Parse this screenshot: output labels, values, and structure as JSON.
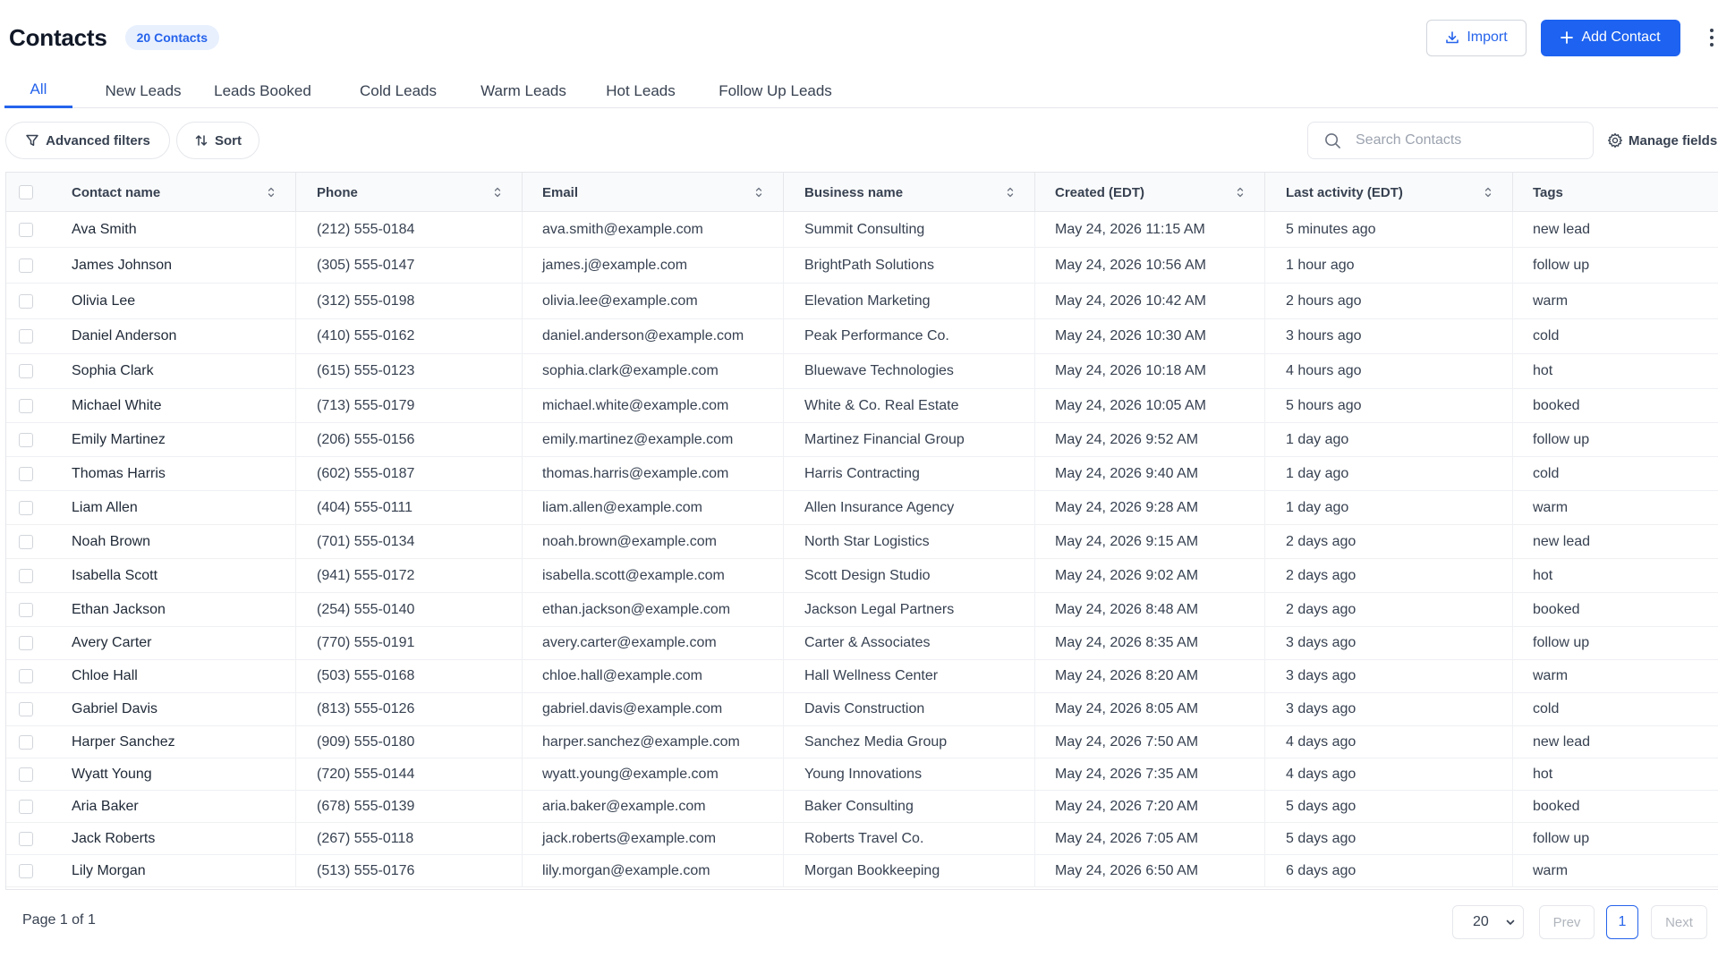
{
  "header": {
    "title": "Contacts",
    "count_badge": "20 Contacts",
    "import_label": "Import",
    "add_label": "Add Contact",
    "accent_color": "#1d62f0"
  },
  "tabs": [
    {
      "label": "All",
      "active": true
    },
    {
      "label": "New Leads",
      "active": false
    },
    {
      "label": "Leads Booked",
      "active": false
    },
    {
      "label": "Cold Leads",
      "active": false
    },
    {
      "label": "Warm Leads",
      "active": false
    },
    {
      "label": "Hot Leads",
      "active": false
    },
    {
      "label": "Follow Up Leads",
      "active": false
    }
  ],
  "toolbar": {
    "filters_label": "Advanced filters",
    "sort_label": "Sort",
    "search_placeholder": "Search Contacts",
    "manage_label": "Manage fields"
  },
  "table": {
    "columns": [
      "Contact name",
      "Phone",
      "Email",
      "Business name",
      "Created (EDT)",
      "Last activity (EDT)",
      "Tags"
    ],
    "rows": [
      [
        "Ava Smith",
        "(212) 555-0184",
        "ava.smith@example.com",
        "Summit Consulting",
        "May 24, 2026 11:15 AM",
        "5 minutes ago",
        "new lead"
      ],
      [
        "James Johnson",
        "(305) 555-0147",
        "james.j@example.com",
        "BrightPath Solutions",
        "May 24, 2026 10:56 AM",
        "1 hour ago",
        "follow up"
      ],
      [
        "Olivia Lee",
        "(312) 555-0198",
        "olivia.lee@example.com",
        "Elevation Marketing",
        "May 24, 2026 10:42 AM",
        "2 hours ago",
        "warm"
      ],
      [
        "Daniel Anderson",
        "(410) 555-0162",
        "daniel.anderson@example.com",
        "Peak Performance Co.",
        "May 24, 2026 10:30 AM",
        "3 hours ago",
        "cold"
      ],
      [
        "Sophia Clark",
        "(615) 555-0123",
        "sophia.clark@example.com",
        "Bluewave Technologies",
        "May 24, 2026 10:18 AM",
        "4 hours ago",
        "hot"
      ],
      [
        "Michael White",
        "(713) 555-0179",
        "michael.white@example.com",
        "White & Co. Real Estate",
        "May 24, 2026 10:05 AM",
        "5 hours ago",
        "booked"
      ],
      [
        "Emily Martinez",
        "(206) 555-0156",
        "emily.martinez@example.com",
        "Martinez Financial Group",
        "May 24, 2026 9:52 AM",
        "1 day ago",
        "follow up"
      ],
      [
        "Thomas Harris",
        "(602) 555-0187",
        "thomas.harris@example.com",
        "Harris Contracting",
        "May 24, 2026 9:40 AM",
        "1 day ago",
        "cold"
      ],
      [
        "Liam Allen",
        "(404) 555-0111",
        "liam.allen@example.com",
        "Allen Insurance Agency",
        "May 24, 2026 9:28 AM",
        "1 day ago",
        "warm"
      ],
      [
        "Noah Brown",
        "(701) 555-0134",
        "noah.brown@example.com",
        "North Star Logistics",
        "May 24, 2026 9:15 AM",
        "2 days ago",
        "new lead"
      ],
      [
        "Isabella Scott",
        "(941) 555-0172",
        "isabella.scott@example.com",
        "Scott Design Studio",
        "May 24, 2026 9:02 AM",
        "2 days ago",
        "hot"
      ],
      [
        "Ethan Jackson",
        "(254) 555-0140",
        "ethan.jackson@example.com",
        "Jackson Legal Partners",
        "May 24, 2026 8:48 AM",
        "2 days ago",
        "booked"
      ],
      [
        "Avery Carter",
        "(770) 555-0191",
        "avery.carter@example.com",
        "Carter & Associates",
        "May 24, 2026 8:35 AM",
        "3 days ago",
        "follow up"
      ],
      [
        "Chloe Hall",
        "(503) 555-0168",
        "chloe.hall@example.com",
        "Hall Wellness Center",
        "May 24, 2026 8:20 AM",
        "3 days ago",
        "warm"
      ],
      [
        "Gabriel Davis",
        "(813) 555-0126",
        "gabriel.davis@example.com",
        "Davis Construction",
        "May 24, 2026 8:05 AM",
        "3 days ago",
        "cold"
      ],
      [
        "Harper Sanchez",
        "(909) 555-0180",
        "harper.sanchez@example.com",
        "Sanchez Media Group",
        "May 24, 2026 7:50 AM",
        "4 days ago",
        "new lead"
      ],
      [
        "Wyatt Young",
        "(720) 555-0144",
        "wyatt.young@example.com",
        "Young Innovations",
        "May 24, 2026 7:35 AM",
        "4 days ago",
        "hot"
      ],
      [
        "Aria Baker",
        "(678) 555-0139",
        "aria.baker@example.com",
        "Baker Consulting",
        "May 24, 2026 7:20 AM",
        "5 days ago",
        "booked"
      ],
      [
        "Jack Roberts",
        "(267) 555-0118",
        "jack.roberts@example.com",
        "Roberts Travel Co.",
        "May 24, 2026 7:05 AM",
        "5 days ago",
        "follow up"
      ],
      [
        "Lily Morgan",
        "(513) 555-0176",
        "lily.morgan@example.com",
        "Morgan Bookkeeping",
        "May 24, 2026 6:50 AM",
        "6 days ago",
        "warm"
      ]
    ]
  },
  "footer": {
    "page_info": "Page 1 of 1",
    "per_page": "20",
    "prev_label": "Prev",
    "current_page": "1",
    "next_label": "Next"
  }
}
